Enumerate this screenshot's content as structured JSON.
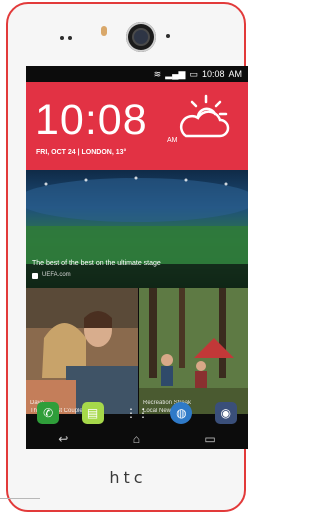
{
  "status": {
    "time": "10:08",
    "ampm": "AM"
  },
  "clock": {
    "time": "10:08",
    "ampm": "AM",
    "date": "FRI, OCT 24 | LONDON, 13°"
  },
  "news": {
    "headline": "The best of the best on the ultimate stage",
    "source": "UEFA.com"
  },
  "tiles": {
    "left": {
      "label1": "Dave",
      "label2": "The Biggest Couple"
    },
    "right": {
      "label1": "Recreation Streak",
      "label2": "Local News"
    }
  },
  "brand": "htc",
  "colors": {
    "accent": "#e23244",
    "frame": "#e23a3a"
  }
}
